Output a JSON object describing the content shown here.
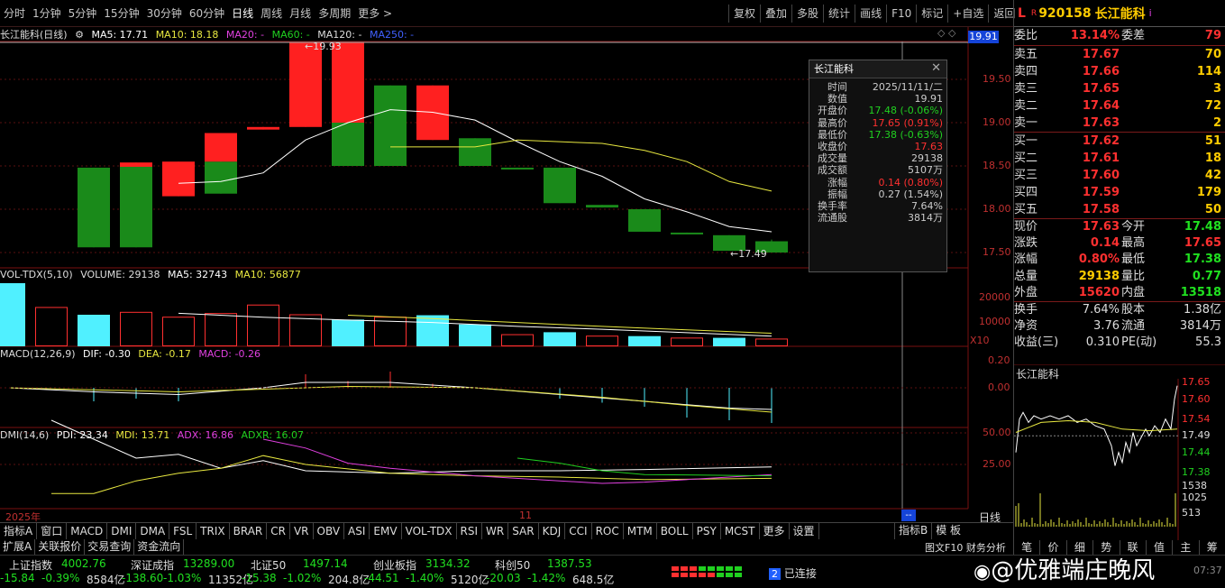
{
  "toolbar": {
    "periods": [
      "分时",
      "1分钟",
      "5分钟",
      "15分钟",
      "30分钟",
      "60分钟",
      "日线",
      "周线",
      "月线",
      "多周期",
      "更多 >"
    ],
    "active_index": 6,
    "right": [
      "复权",
      "叠加",
      "多股",
      "统计",
      "画线",
      "F10",
      "标记",
      "+自选",
      "返回"
    ]
  },
  "main_chart": {
    "title": "长江能科(日线)",
    "ma": {
      "ma5": "MA5: 17.71",
      "ma10": "MA10: 18.18",
      "ma20": "MA20: -",
      "ma60": "MA60: -",
      "ma120": "MA120: -",
      "ma250": "MA250: -"
    },
    "high_label": "19.93",
    "low_label": "17.49",
    "high_box": "19.91",
    "axis_labels": [
      "19.50",
      "19.00",
      "18.50",
      "18.00",
      "17.50"
    ],
    "colors": {
      "up": "#ff2020",
      "down": "#1a8a1a",
      "ma5": "#ffffff",
      "ma10": "#e8e840",
      "bg": "#000000",
      "grid": "#7a1010"
    }
  },
  "tooltip": {
    "title": "长江能科",
    "rows": [
      [
        "时间",
        "2025/11/11/二",
        "#cccccc"
      ],
      [
        "数值",
        "19.91",
        "#cccccc"
      ],
      [
        "开盘价",
        "17.48 (-0.06%)",
        "#20d020"
      ],
      [
        "最高价",
        "17.65 (0.91%)",
        "#ff3030"
      ],
      [
        "最低价",
        "17.38 (-0.63%)",
        "#20d020"
      ],
      [
        "收盘价",
        "17.63",
        "#ff3030"
      ],
      [
        "成交量",
        "29138",
        "#cccccc"
      ],
      [
        "成交额",
        "5107万",
        "#cccccc"
      ],
      [
        "涨幅",
        "0.14 (0.80%)",
        "#ff3030"
      ],
      [
        "振幅",
        "0.27 (1.54%)",
        "#cccccc"
      ],
      [
        "换手率",
        "7.64%",
        "#cccccc"
      ],
      [
        "流通股",
        "3814万",
        "#cccccc"
      ]
    ]
  },
  "volume": {
    "title": "VOL-TDX(5,10)",
    "vol": "VOLUME: 29138",
    "ma5": "MA5: 32743",
    "ma10": "MA10: 56877",
    "axis_labels": [
      "20000",
      "10000"
    ],
    "unit": "X10"
  },
  "macd": {
    "title": "MACD(12,26,9)",
    "dif": "DIF: -0.30",
    "dea": "DEA: -0.17",
    "macd": "MACD: -0.26",
    "axis_labels": [
      "0.20",
      "0.00"
    ]
  },
  "dmi": {
    "title": "DMI(14,6)",
    "pdi": "PDI: 23.34",
    "mdi": "MDI: 13.71",
    "adx": "ADX: 16.86",
    "adxr": "ADXR: 16.07",
    "axis_labels": [
      "50.00",
      "25.00"
    ]
  },
  "date_axis": {
    "left": "2025年",
    "mid": "11",
    "right_tab": "日线"
  },
  "indicator_tabs": [
    "指标A",
    "窗口",
    "MACD",
    "DMI",
    "DMA",
    "FSL",
    "TRIX",
    "BRAR",
    "CR",
    "VR",
    "OBV",
    "ASI",
    "EMV",
    "VOL-TDX",
    "RSI",
    "WR",
    "SAR",
    "KDJ",
    "CCI",
    "ROC",
    "MTM",
    "BOLL",
    "PSY",
    "MCST",
    "更多",
    "设置"
  ],
  "indicator_tabs_right": [
    "指标B",
    "模 板"
  ],
  "sub_tabs": [
    "扩展A",
    "关联报价",
    "交易查询",
    "资金流向"
  ],
  "sub_tabs_right": "图文F10 财务分析",
  "status": {
    "indices": [
      {
        "name": "上证指数",
        "value": "4002.76",
        "chg": "-15.84",
        "pct": "-0.39%",
        "amt": "8584亿"
      },
      {
        "name": "深证成指",
        "value": "13289.00",
        "chg": "-138.60",
        "pct": "-1.03%",
        "amt": "11352亿"
      },
      {
        "name": "北证50",
        "value": "1497.14",
        "chg": "-15.38",
        "pct": "-1.02%",
        "amt": "204.8亿"
      },
      {
        "name": "创业板指",
        "value": "3134.32",
        "chg": "-44.51",
        "pct": "-1.40%",
        "amt": "5120亿"
      },
      {
        "name": "科创50",
        "value": "1387.53",
        "chg": "-20.03",
        "pct": "-1.42%",
        "amt": "648.5亿"
      }
    ],
    "connected": "已连接",
    "conn_num": "2",
    "watermark": "@优雅端庄晚风",
    "clock": "07:37"
  },
  "right_panel": {
    "flag": "L",
    "code": "920158",
    "name": "长江能科",
    "mark": "i",
    "weibi": {
      "label": "委比",
      "value": "13.14%",
      "label2": "委差",
      "value2": "79"
    },
    "asks": [
      [
        "卖五",
        "17.67",
        "70"
      ],
      [
        "卖四",
        "17.66",
        "114"
      ],
      [
        "卖三",
        "17.65",
        "3"
      ],
      [
        "卖二",
        "17.64",
        "72"
      ],
      [
        "卖一",
        "17.63",
        "2"
      ]
    ],
    "bids": [
      [
        "买一",
        "17.62",
        "51"
      ],
      [
        "买二",
        "17.61",
        "18"
      ],
      [
        "买三",
        "17.60",
        "42"
      ],
      [
        "买四",
        "17.59",
        "179"
      ],
      [
        "买五",
        "17.58",
        "50"
      ]
    ],
    "quote": [
      [
        "现价",
        "17.63",
        "#ff3030",
        "今开",
        "17.48",
        "#20e020"
      ],
      [
        "涨跌",
        "0.14",
        "#ff3030",
        "最高",
        "17.65",
        "#ff3030"
      ],
      [
        "涨幅",
        "0.80%",
        "#ff3030",
        "最低",
        "17.38",
        "#20e020"
      ],
      [
        "总量",
        "29138",
        "#ffcc00",
        "量比",
        "0.77",
        "#20e020"
      ],
      [
        "外盘",
        "15620",
        "#ff3030",
        "内盘",
        "13518",
        "#20e020"
      ]
    ],
    "quote2": [
      [
        "换手",
        "7.64%",
        "#dddddd",
        "股本",
        "1.38亿",
        "#dddddd"
      ],
      [
        "净资",
        "3.76",
        "#dddddd",
        "流通",
        "3814万",
        "#dddddd"
      ],
      [
        "收益(三)",
        "0.310",
        "#dddddd",
        "PE(动)",
        "55.3",
        "#dddddd"
      ]
    ],
    "mini_title": "长江能科",
    "mini_axis": [
      "17.65",
      "17.60",
      "17.54",
      "17.49",
      "17.44",
      "17.38"
    ],
    "mini_vol_axis": [
      "1538",
      "1025",
      "513"
    ],
    "mini_tabs": [
      "笔",
      "价",
      "细",
      "势",
      "联",
      "值",
      "主",
      "筹"
    ]
  }
}
